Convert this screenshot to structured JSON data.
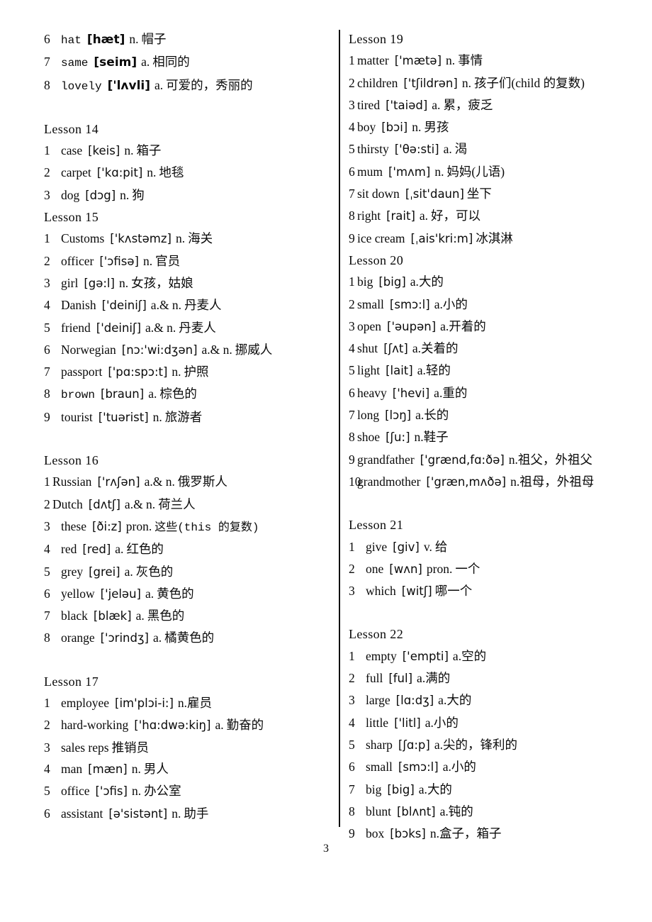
{
  "page": {
    "number": "3"
  },
  "columns": {
    "left": [
      {
        "kind": "entry",
        "style": "w",
        "num": "6",
        "word": "hat",
        "word_mono": true,
        "ipa": "[hæt]",
        "ipa_bold": true,
        "pos": "n.",
        "def": "帽子"
      },
      {
        "kind": "entry",
        "style": "w",
        "num": "7",
        "word": "same",
        "word_mono": true,
        "ipa": "[seim]",
        "ipa_bold": true,
        "pos": "a.",
        "def": "相同的"
      },
      {
        "kind": "entry",
        "style": "w",
        "num": "8",
        "word": "lovely",
        "word_mono": true,
        "ipa": "['lʌvli]",
        "ipa_bold": true,
        "pos": "a.",
        "def": "可爱的，秀丽的"
      },
      {
        "kind": "spacer"
      },
      {
        "kind": "lesson",
        "label": "Lesson  14"
      },
      {
        "kind": "entry",
        "style": "w",
        "num": "1",
        "word": "case",
        "ipa": "[keis]",
        "pos": "n.",
        "def": "箱子"
      },
      {
        "kind": "entry",
        "style": "w",
        "num": "2",
        "word": "carpet",
        "ipa": "['kɑ:pit]",
        "pos": "n.",
        "def": "地毯"
      },
      {
        "kind": "entry",
        "style": "w",
        "num": "3",
        "word": "dog",
        "ipa": "[dɔg]",
        "pos": "n.",
        "def": "狗"
      },
      {
        "kind": "lesson",
        "label": "Lesson  15"
      },
      {
        "kind": "entry",
        "style": "w",
        "num": "1",
        "word": "Customs",
        "ipa": "['kʌstəmz]",
        "pos": "n.",
        "def": "海关"
      },
      {
        "kind": "entry",
        "style": "w",
        "num": "2",
        "word": "officer",
        "ipa": "['ɔfisə]",
        "pos": "n.",
        "def": "官员"
      },
      {
        "kind": "entry",
        "style": "w",
        "num": "3",
        "word": "girl",
        "ipa": "[gə:l]",
        "pos": "n.",
        "def": "女孩，姑娘"
      },
      {
        "kind": "entry",
        "style": "w",
        "num": "4",
        "word": "Danish",
        "ipa": "['deiniʃ]",
        "pos": "a.& n.",
        "def": "丹麦人"
      },
      {
        "kind": "entry",
        "style": "w",
        "num": "5",
        "word": "friend",
        "ipa": "['deiniʃ]",
        "pos": "a.& n.",
        "def": "丹麦人"
      },
      {
        "kind": "entry",
        "style": "w",
        "num": "6",
        "word": "Norwegian",
        "ipa": "[nɔ:'wi:dʒən]",
        "pos": "a.& n.",
        "def": "挪威人"
      },
      {
        "kind": "entry",
        "style": "w",
        "num": "7",
        "word": "passport",
        "ipa": "['pɑ:spɔ:t]",
        "pos": "n.",
        "def": "护照"
      },
      {
        "kind": "entry",
        "style": "w",
        "num": "8",
        "word": "brown",
        "word_mono": true,
        "ipa": "[braun]",
        "pos": "a.",
        "def": "棕色的"
      },
      {
        "kind": "entry",
        "style": "w",
        "num": "9",
        "word": "tourist",
        "ipa": "['tuərist]",
        "pos": "n.",
        "def": "旅游者"
      },
      {
        "kind": "spacer"
      },
      {
        "kind": "lesson",
        "label": "Lesson  16"
      },
      {
        "kind": "entry",
        "style": "t",
        "num": "1",
        "word": "Russian",
        "ipa": "['rʌʃən]",
        "pos": "a.& n.",
        "def": "俄罗斯人"
      },
      {
        "kind": "entry",
        "style": "t",
        "num": "2",
        "word": "Dutch",
        "ipa": "[dʌtʃ]",
        "pos": "a.& n.",
        "def": "荷兰人"
      },
      {
        "kind": "entry",
        "style": "w",
        "num": "3",
        "word": "these",
        "ipa": "[ði:z]",
        "pos": "pron.",
        "def": "这些(this 的复数)",
        "def_mono": true
      },
      {
        "kind": "entry",
        "style": "w",
        "num": "4",
        "word": "red",
        "ipa": "[red]",
        "pos": "a.",
        "def": "红色的"
      },
      {
        "kind": "entry",
        "style": "w",
        "num": "5",
        "word": "grey",
        "ipa": "[grei]",
        "pos": "a.",
        "def": "灰色的"
      },
      {
        "kind": "entry",
        "style": "w",
        "num": "6",
        "word": "yellow",
        "ipa": "['jeləu]",
        "pos": "a.",
        "def": "黄色的"
      },
      {
        "kind": "entry",
        "style": "w",
        "num": "7",
        "word": "black",
        "ipa": "[blæk]",
        "pos": "a.",
        "def": "黑色的"
      },
      {
        "kind": "entry",
        "style": "w",
        "num": "8",
        "word": "orange",
        "ipa": "['ɔrindʒ]",
        "pos": "a.",
        "def": "橘黄色的"
      },
      {
        "kind": "spacer"
      },
      {
        "kind": "lesson",
        "label": "Lesson  17"
      },
      {
        "kind": "entry",
        "style": "w",
        "num": "1",
        "word": "employee",
        "ipa": "[im'plɔi-i:]",
        "pos": "n.",
        "def": "雇员",
        "tight": true
      },
      {
        "kind": "entry",
        "style": "w",
        "num": "2",
        "word": "hard-working",
        "ipa": "['hɑ:dwə:kiŋ]",
        "pos": "a.",
        "def": "勤奋的"
      },
      {
        "kind": "entry",
        "style": "w",
        "num": "3",
        "word": "sales reps",
        "ipa": "",
        "pos": "",
        "def": "推销员"
      },
      {
        "kind": "entry",
        "style": "w",
        "num": "4",
        "word": "man",
        "ipa": "[mæn]",
        "pos": "n.",
        "def": "男人"
      },
      {
        "kind": "entry",
        "style": "w",
        "num": "5",
        "word": "office",
        "ipa": "['ɔfis]",
        "pos": "n.",
        "def": "办公室"
      },
      {
        "kind": "entry",
        "style": "w",
        "num": "6",
        "word": "assistant",
        "ipa": "[ə'sistənt]",
        "pos": "n.",
        "def": "助手"
      }
    ],
    "right": [
      {
        "kind": "lesson",
        "label": "Lesson  19"
      },
      {
        "kind": "entry",
        "style": "t",
        "num": "1",
        "word": "matter",
        "ipa": "['mætə]",
        "pos": "n.",
        "def": "事情"
      },
      {
        "kind": "entry",
        "style": "t",
        "num": "2",
        "word": "children",
        "ipa": "['tʃildrən]",
        "pos": "n.",
        "def": "孩子们(child 的复数)"
      },
      {
        "kind": "entry",
        "style": "t",
        "num": "3",
        "word": "tired",
        "ipa": "['taiəd]",
        "pos": "a.",
        "def": "累，疲乏"
      },
      {
        "kind": "entry",
        "style": "t",
        "num": "4",
        "word": "boy",
        "ipa": "[bɔi]",
        "pos": "n.",
        "def": "男孩"
      },
      {
        "kind": "entry",
        "style": "t",
        "num": "5",
        "word": "thirsty",
        "ipa": "['θə:sti]",
        "pos": "a.",
        "def": "渴"
      },
      {
        "kind": "entry",
        "style": "t",
        "num": "6",
        "word": "mum",
        "ipa": "['mʌm]",
        "pos": "n.",
        "def": "妈妈(儿语)"
      },
      {
        "kind": "entry",
        "style": "t",
        "num": "7",
        "word": "sit down",
        "ipa": "[ˌsit'daun]",
        "pos": "",
        "def": "坐下"
      },
      {
        "kind": "entry",
        "style": "t",
        "num": "8",
        "word": "right",
        "ipa": "[rait]",
        "pos": "a.",
        "def": "好，可以"
      },
      {
        "kind": "entry",
        "style": "t",
        "num": "9",
        "word": "ice cream",
        "ipa": "[ˌais'kri:m]",
        "pos": "",
        "def": "冰淇淋"
      },
      {
        "kind": "lesson",
        "label": "Lesson  20"
      },
      {
        "kind": "entry",
        "style": "t",
        "num": "1",
        "word": "big",
        "ipa": "[big]",
        "pos": "a.",
        "def": "大的",
        "tight": true
      },
      {
        "kind": "entry",
        "style": "t",
        "num": "2",
        "word": "small",
        "ipa": "[smɔ:l]",
        "pos": "a.",
        "def": "小的",
        "tight": true
      },
      {
        "kind": "entry",
        "style": "t",
        "num": "3",
        "word": "open",
        "ipa": "['əupən]",
        "pos": "a.",
        "def": "开着的",
        "tight": true
      },
      {
        "kind": "entry",
        "style": "t",
        "num": "4",
        "word": "shut",
        "ipa": "[ʃʌt]",
        "pos": "a.",
        "def": "关着的",
        "tight": true
      },
      {
        "kind": "entry",
        "style": "t",
        "num": "5",
        "word": "light",
        "ipa": "[lait]",
        "pos": "a.",
        "def": "轻的",
        "tight": true
      },
      {
        "kind": "entry",
        "style": "t",
        "num": "6",
        "word": "heavy",
        "ipa": "['hevi]",
        "pos": "a.",
        "def": "重的",
        "tight": true
      },
      {
        "kind": "entry",
        "style": "t",
        "num": "7",
        "word": "long",
        "ipa": "[lɔŋ]",
        "pos": "a.",
        "def": "长的",
        "tight": true
      },
      {
        "kind": "entry",
        "style": "t",
        "num": "8",
        "word": "shoe",
        "ipa": "[ʃu:]",
        "pos": "n.",
        "def": "鞋子",
        "tight": true
      },
      {
        "kind": "entry",
        "style": "t",
        "num": "9",
        "word": "grandfather",
        "ipa": "['grænd,fɑ:ðə]",
        "pos": "n.",
        "def": "祖父，外祖父",
        "tight": true
      },
      {
        "kind": "entry",
        "style": "t",
        "num": "10",
        "word": "grandmother",
        "ipa": "['græn,mʌðə]",
        "pos": "n.",
        "def": "祖母，外祖母",
        "tight": true
      },
      {
        "kind": "spacer"
      },
      {
        "kind": "lesson",
        "label": "Lesson  21"
      },
      {
        "kind": "entry",
        "style": "w",
        "num": "1",
        "word": "give",
        "ipa": "[giv]",
        "pos": "v.",
        "def": "给"
      },
      {
        "kind": "entry",
        "style": "w",
        "num": "2",
        "word": "one",
        "ipa": "[wʌn]",
        "pos": "pron.",
        "def": "一个"
      },
      {
        "kind": "entry",
        "style": "w",
        "num": "3",
        "word": "which",
        "ipa": "[witʃ]",
        "pos": "",
        "def": "哪一个"
      },
      {
        "kind": "spacer"
      },
      {
        "kind": "lesson",
        "label": "Lesson  22"
      },
      {
        "kind": "entry",
        "style": "w",
        "num": "1",
        "word": "empty",
        "ipa": "['empti]",
        "pos": "a.",
        "def": "空的",
        "tight": true
      },
      {
        "kind": "entry",
        "style": "w",
        "num": "2",
        "word": "full",
        "ipa": "[ful]",
        "pos": "a.",
        "def": "满的",
        "tight": true
      },
      {
        "kind": "entry",
        "style": "w",
        "num": "3",
        "word": "large",
        "ipa": "[lɑ:dʒ]",
        "pos": "a.",
        "def": "大的",
        "tight": true
      },
      {
        "kind": "entry",
        "style": "w",
        "num": "4",
        "word": "little",
        "ipa": "['litl]",
        "pos": "a.",
        "def": "小的",
        "tight": true
      },
      {
        "kind": "entry",
        "style": "w",
        "num": "5",
        "word": "sharp",
        "ipa": "[ʃɑ:p]",
        "pos": "a.",
        "def": "尖的，锋利的",
        "tight": true
      },
      {
        "kind": "entry",
        "style": "w",
        "num": "6",
        "word": "small",
        "ipa": "[smɔ:l]",
        "pos": "a.",
        "def": "小的",
        "tight": true
      },
      {
        "kind": "entry",
        "style": "w",
        "num": "7",
        "word": "big",
        "ipa": "[big]",
        "pos": "a.",
        "def": "大的",
        "tight": true
      },
      {
        "kind": "entry",
        "style": "w",
        "num": "8",
        "word": "blunt",
        "ipa": "[blʌnt]",
        "pos": "a.",
        "def": "钝的",
        "tight": true
      },
      {
        "kind": "entry",
        "style": "w",
        "num": "9",
        "word": "box",
        "ipa": "[bɔks]",
        "pos": "n.",
        "def": "盒子，箱子",
        "tight": true
      }
    ]
  }
}
